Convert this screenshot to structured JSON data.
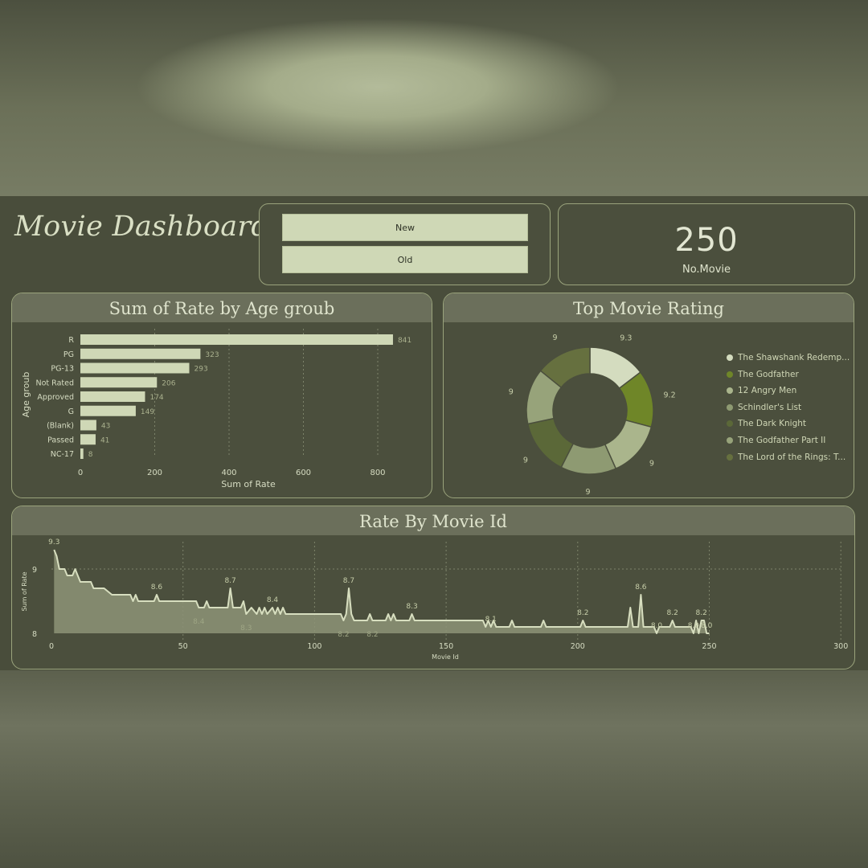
{
  "header": {
    "title": "Movie Dashboard"
  },
  "slicer": {
    "buttons": [
      "New",
      "Old"
    ]
  },
  "kpi": {
    "value": "250",
    "label": "No.Movie"
  },
  "panels": {
    "age": "Sum of Rate by Age groub",
    "top": "Top Movie Rating",
    "rate": "Rate By Movie Id"
  },
  "colors": {
    "bar": "#cfd8b6",
    "line": "#d7debf",
    "area": "#8d9377",
    "donut": [
      "#d4dcbf",
      "#6f8628",
      "#aab58c",
      "#8e9a72",
      "#5b6838",
      "#97a37a",
      "#66703f"
    ]
  },
  "chart_data": [
    {
      "type": "bar",
      "orientation": "horizontal",
      "title": "Sum of Rate by Age groub",
      "xlabel": "Sum of Rate",
      "ylabel": "Age groub",
      "categories": [
        "R",
        "PG",
        "PG-13",
        "Not Rated",
        "Approved",
        "G",
        "(Blank)",
        "Passed",
        "NC-17"
      ],
      "values": [
        841,
        323,
        293,
        206,
        174,
        149,
        43,
        41,
        8
      ],
      "xlim": [
        0,
        900
      ],
      "xticks": [
        0,
        200,
        400,
        600,
        800
      ],
      "grid": true
    },
    {
      "type": "pie",
      "donut": true,
      "title": "Top Movie Rating",
      "categories": [
        "The Shawshank Redemp...",
        "The Godfather",
        "12 Angry Men",
        "Schindler's List",
        "The Dark Knight",
        "The Godfather Part II",
        "The Lord of the Rings: T..."
      ],
      "values": [
        9.3,
        9.2,
        9,
        9,
        9,
        9,
        9
      ],
      "data_labels": [
        "9.3",
        "9.2",
        "9",
        "9",
        "9",
        "9",
        "9"
      ],
      "legend": "right"
    },
    {
      "type": "area",
      "title": "Rate By Movie Id",
      "xlabel": "Movie Id",
      "ylabel": "Sum of Rate",
      "xlim": [
        0,
        300
      ],
      "ylim": [
        8,
        9.3
      ],
      "xticks": [
        0,
        50,
        100,
        150,
        200,
        250,
        300
      ],
      "yticks": [
        8,
        9
      ],
      "grid": true,
      "points": [
        [
          1,
          9.3
        ],
        [
          2,
          9.2
        ],
        [
          3,
          9.0
        ],
        [
          4,
          9.0
        ],
        [
          5,
          9.0
        ],
        [
          6,
          8.9
        ],
        [
          7,
          8.9
        ],
        [
          8,
          8.9
        ],
        [
          9,
          9.0
        ],
        [
          10,
          8.9
        ],
        [
          11,
          8.8
        ],
        [
          12,
          8.8
        ],
        [
          13,
          8.8
        ],
        [
          14,
          8.8
        ],
        [
          15,
          8.8
        ],
        [
          16,
          8.7
        ],
        [
          18,
          8.7
        ],
        [
          20,
          8.7
        ],
        [
          23,
          8.6
        ],
        [
          30,
          8.6
        ],
        [
          31,
          8.5
        ],
        [
          32,
          8.6
        ],
        [
          33,
          8.5
        ],
        [
          39,
          8.5
        ],
        [
          40,
          8.6
        ],
        [
          41,
          8.5
        ],
        [
          55,
          8.5
        ],
        [
          56,
          8.4
        ],
        [
          58,
          8.4
        ],
        [
          59,
          8.5
        ],
        [
          60,
          8.4
        ],
        [
          67,
          8.4
        ],
        [
          68,
          8.7
        ],
        [
          69,
          8.4
        ],
        [
          72,
          8.4
        ],
        [
          73,
          8.5
        ],
        [
          74,
          8.3
        ],
        [
          76,
          8.4
        ],
        [
          78,
          8.3
        ],
        [
          79,
          8.4
        ],
        [
          80,
          8.3
        ],
        [
          81,
          8.4
        ],
        [
          82,
          8.3
        ],
        [
          84,
          8.4
        ],
        [
          85,
          8.3
        ],
        [
          86,
          8.4
        ],
        [
          87,
          8.3
        ],
        [
          88,
          8.4
        ],
        [
          89,
          8.3
        ],
        [
          110,
          8.3
        ],
        [
          111,
          8.2
        ],
        [
          112,
          8.3
        ],
        [
          113,
          8.7
        ],
        [
          114,
          8.3
        ],
        [
          115,
          8.2
        ],
        [
          120,
          8.2
        ],
        [
          121,
          8.3
        ],
        [
          122,
          8.2
        ],
        [
          127,
          8.2
        ],
        [
          128,
          8.3
        ],
        [
          129,
          8.2
        ],
        [
          130,
          8.3
        ],
        [
          131,
          8.2
        ],
        [
          136,
          8.2
        ],
        [
          137,
          8.3
        ],
        [
          138,
          8.2
        ],
        [
          164,
          8.2
        ],
        [
          165,
          8.1
        ],
        [
          166,
          8.2
        ],
        [
          167,
          8.1
        ],
        [
          168,
          8.2
        ],
        [
          169,
          8.1
        ],
        [
          174,
          8.1
        ],
        [
          175,
          8.2
        ],
        [
          176,
          8.1
        ],
        [
          186,
          8.1
        ],
        [
          187,
          8.2
        ],
        [
          188,
          8.1
        ],
        [
          201,
          8.1
        ],
        [
          202,
          8.2
        ],
        [
          203,
          8.1
        ],
        [
          219,
          8.1
        ],
        [
          220,
          8.4
        ],
        [
          221,
          8.1
        ],
        [
          223,
          8.1
        ],
        [
          224,
          8.6
        ],
        [
          225,
          8.1
        ],
        [
          229,
          8.1
        ],
        [
          230,
          8.0
        ],
        [
          231,
          8.1
        ],
        [
          235,
          8.1
        ],
        [
          236,
          8.2
        ],
        [
          237,
          8.1
        ],
        [
          243,
          8.1
        ],
        [
          244,
          8.0
        ],
        [
          245,
          8.2
        ],
        [
          246,
          8.0
        ],
        [
          247,
          8.2
        ],
        [
          248,
          8.2
        ],
        [
          249,
          8.0
        ],
        [
          250,
          8.0
        ]
      ],
      "data_labels": [
        {
          "x": 1,
          "y": 9.3,
          "label": "9.3"
        },
        {
          "x": 40,
          "y": 8.6,
          "label": "8.6"
        },
        {
          "x": 56,
          "y": 8.4,
          "label": "8.4"
        },
        {
          "x": 68,
          "y": 8.7,
          "label": "8.7"
        },
        {
          "x": 74,
          "y": 8.3,
          "label": "8.3"
        },
        {
          "x": 84,
          "y": 8.4,
          "label": "8.4"
        },
        {
          "x": 111,
          "y": 8.2,
          "label": "8.2"
        },
        {
          "x": 113,
          "y": 8.7,
          "label": "8.7"
        },
        {
          "x": 122,
          "y": 8.2,
          "label": "8.2"
        },
        {
          "x": 137,
          "y": 8.3,
          "label": "8.3"
        },
        {
          "x": 167,
          "y": 8.1,
          "label": "8.1"
        },
        {
          "x": 202,
          "y": 8.2,
          "label": "8.2"
        },
        {
          "x": 224,
          "y": 8.6,
          "label": "8.6"
        },
        {
          "x": 230,
          "y": 8.0,
          "label": "8.0"
        },
        {
          "x": 236,
          "y": 8.2,
          "label": "8.2"
        },
        {
          "x": 244,
          "y": 8.0,
          "label": "8.0"
        },
        {
          "x": 247,
          "y": 8.2,
          "label": "8.2"
        },
        {
          "x": 249,
          "y": 8.0,
          "label": "8.0"
        }
      ]
    }
  ]
}
